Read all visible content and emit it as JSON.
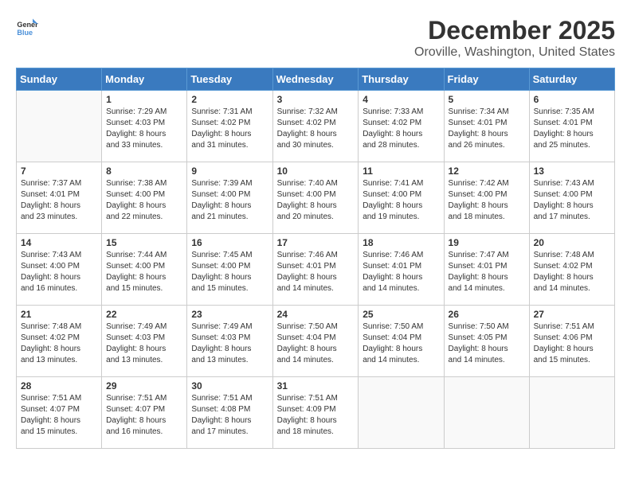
{
  "header": {
    "logo_general": "General",
    "logo_blue": "Blue",
    "title": "December 2025",
    "subtitle": "Oroville, Washington, United States"
  },
  "calendar": {
    "days_of_week": [
      "Sunday",
      "Monday",
      "Tuesday",
      "Wednesday",
      "Thursday",
      "Friday",
      "Saturday"
    ],
    "weeks": [
      [
        {
          "day": "",
          "info": ""
        },
        {
          "day": "1",
          "info": "Sunrise: 7:29 AM\nSunset: 4:03 PM\nDaylight: 8 hours\nand 33 minutes."
        },
        {
          "day": "2",
          "info": "Sunrise: 7:31 AM\nSunset: 4:02 PM\nDaylight: 8 hours\nand 31 minutes."
        },
        {
          "day": "3",
          "info": "Sunrise: 7:32 AM\nSunset: 4:02 PM\nDaylight: 8 hours\nand 30 minutes."
        },
        {
          "day": "4",
          "info": "Sunrise: 7:33 AM\nSunset: 4:02 PM\nDaylight: 8 hours\nand 28 minutes."
        },
        {
          "day": "5",
          "info": "Sunrise: 7:34 AM\nSunset: 4:01 PM\nDaylight: 8 hours\nand 26 minutes."
        },
        {
          "day": "6",
          "info": "Sunrise: 7:35 AM\nSunset: 4:01 PM\nDaylight: 8 hours\nand 25 minutes."
        }
      ],
      [
        {
          "day": "7",
          "info": "Sunrise: 7:37 AM\nSunset: 4:01 PM\nDaylight: 8 hours\nand 23 minutes."
        },
        {
          "day": "8",
          "info": "Sunrise: 7:38 AM\nSunset: 4:00 PM\nDaylight: 8 hours\nand 22 minutes."
        },
        {
          "day": "9",
          "info": "Sunrise: 7:39 AM\nSunset: 4:00 PM\nDaylight: 8 hours\nand 21 minutes."
        },
        {
          "day": "10",
          "info": "Sunrise: 7:40 AM\nSunset: 4:00 PM\nDaylight: 8 hours\nand 20 minutes."
        },
        {
          "day": "11",
          "info": "Sunrise: 7:41 AM\nSunset: 4:00 PM\nDaylight: 8 hours\nand 19 minutes."
        },
        {
          "day": "12",
          "info": "Sunrise: 7:42 AM\nSunset: 4:00 PM\nDaylight: 8 hours\nand 18 minutes."
        },
        {
          "day": "13",
          "info": "Sunrise: 7:43 AM\nSunset: 4:00 PM\nDaylight: 8 hours\nand 17 minutes."
        }
      ],
      [
        {
          "day": "14",
          "info": "Sunrise: 7:43 AM\nSunset: 4:00 PM\nDaylight: 8 hours\nand 16 minutes."
        },
        {
          "day": "15",
          "info": "Sunrise: 7:44 AM\nSunset: 4:00 PM\nDaylight: 8 hours\nand 15 minutes."
        },
        {
          "day": "16",
          "info": "Sunrise: 7:45 AM\nSunset: 4:00 PM\nDaylight: 8 hours\nand 15 minutes."
        },
        {
          "day": "17",
          "info": "Sunrise: 7:46 AM\nSunset: 4:01 PM\nDaylight: 8 hours\nand 14 minutes."
        },
        {
          "day": "18",
          "info": "Sunrise: 7:46 AM\nSunset: 4:01 PM\nDaylight: 8 hours\nand 14 minutes."
        },
        {
          "day": "19",
          "info": "Sunrise: 7:47 AM\nSunset: 4:01 PM\nDaylight: 8 hours\nand 14 minutes."
        },
        {
          "day": "20",
          "info": "Sunrise: 7:48 AM\nSunset: 4:02 PM\nDaylight: 8 hours\nand 14 minutes."
        }
      ],
      [
        {
          "day": "21",
          "info": "Sunrise: 7:48 AM\nSunset: 4:02 PM\nDaylight: 8 hours\nand 13 minutes."
        },
        {
          "day": "22",
          "info": "Sunrise: 7:49 AM\nSunset: 4:03 PM\nDaylight: 8 hours\nand 13 minutes."
        },
        {
          "day": "23",
          "info": "Sunrise: 7:49 AM\nSunset: 4:03 PM\nDaylight: 8 hours\nand 13 minutes."
        },
        {
          "day": "24",
          "info": "Sunrise: 7:50 AM\nSunset: 4:04 PM\nDaylight: 8 hours\nand 14 minutes."
        },
        {
          "day": "25",
          "info": "Sunrise: 7:50 AM\nSunset: 4:04 PM\nDaylight: 8 hours\nand 14 minutes."
        },
        {
          "day": "26",
          "info": "Sunrise: 7:50 AM\nSunset: 4:05 PM\nDaylight: 8 hours\nand 14 minutes."
        },
        {
          "day": "27",
          "info": "Sunrise: 7:51 AM\nSunset: 4:06 PM\nDaylight: 8 hours\nand 15 minutes."
        }
      ],
      [
        {
          "day": "28",
          "info": "Sunrise: 7:51 AM\nSunset: 4:07 PM\nDaylight: 8 hours\nand 15 minutes."
        },
        {
          "day": "29",
          "info": "Sunrise: 7:51 AM\nSunset: 4:07 PM\nDaylight: 8 hours\nand 16 minutes."
        },
        {
          "day": "30",
          "info": "Sunrise: 7:51 AM\nSunset: 4:08 PM\nDaylight: 8 hours\nand 17 minutes."
        },
        {
          "day": "31",
          "info": "Sunrise: 7:51 AM\nSunset: 4:09 PM\nDaylight: 8 hours\nand 18 minutes."
        },
        {
          "day": "",
          "info": ""
        },
        {
          "day": "",
          "info": ""
        },
        {
          "day": "",
          "info": ""
        }
      ]
    ]
  }
}
